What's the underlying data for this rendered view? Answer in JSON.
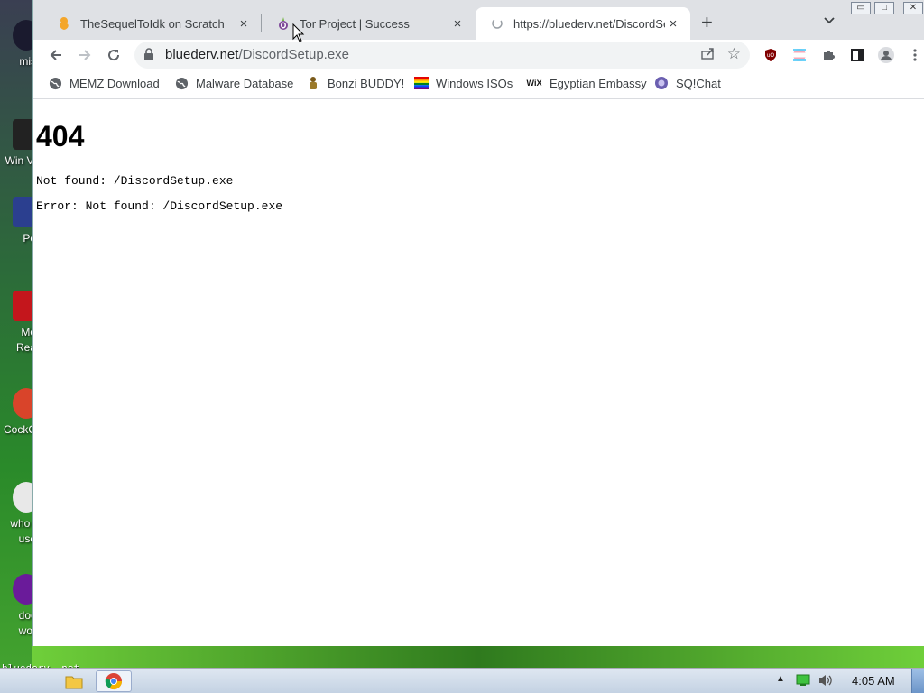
{
  "desktop": {
    "icons": [
      {
        "label": "mis",
        "color": "#1a1a2e"
      },
      {
        "label": "Win Vi",
        "color": "#222222"
      },
      {
        "label": "Pe",
        "color": "#2b3f8f"
      },
      {
        "label": "Mo Rea",
        "color": "#c4161c"
      },
      {
        "label": "CockC",
        "color": "#d9442a"
      },
      {
        "label": "who t use",
        "color": "#e8e8e8"
      },
      {
        "label": "doc wor",
        "color": "#6a1b9a"
      }
    ],
    "watermark": "bluederv .net"
  },
  "browser": {
    "tabs": [
      {
        "title": "TheSequelToIdk on Scratch",
        "favicon": "scratch-icon",
        "close": "×"
      },
      {
        "title": "Tor Project | Success",
        "favicon": "tor-onion-icon",
        "close": "×"
      },
      {
        "title": "https://bluederv.net/DiscordSe",
        "favicon": "loading-icon",
        "close": "×"
      }
    ],
    "new_tab": "+",
    "tab_search": "⌄",
    "window_controls": {
      "minimize": "▭",
      "maximize": "□",
      "close": "✕"
    },
    "url": {
      "host": "bluederv.net",
      "path": "/DiscordSetup.exe"
    },
    "bookmarks": [
      {
        "label": "MEMZ Download",
        "icon": "globe-icon"
      },
      {
        "label": "Malware Database",
        "icon": "globe-icon"
      },
      {
        "label": "Bonzi BUDDY!",
        "icon": "bonzi-icon"
      },
      {
        "label": "Windows ISOs",
        "icon": "rainbow-flag-icon"
      },
      {
        "label": "Egyptian Embassy",
        "icon": "wix-icon",
        "icon_text": "WiX"
      },
      {
        "label": "SQ!Chat",
        "icon": "sqchat-icon"
      }
    ]
  },
  "page": {
    "heading": "404",
    "line1": "Not found: /DiscordSetup.exe",
    "line2": "Error: Not found: /DiscordSetup.exe"
  },
  "taskbar": {
    "clock": "4:05 AM"
  },
  "colors": {
    "tabstrip": "#dfe1e5",
    "omnibox": "#f1f3f4",
    "taskbar": "#c4d2e3"
  }
}
